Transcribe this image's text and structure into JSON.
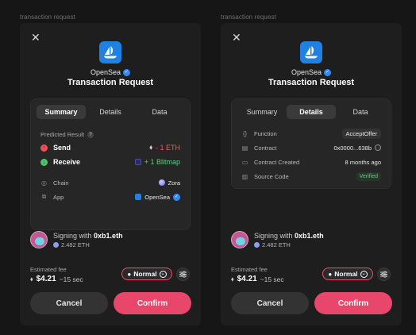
{
  "frame_label": "transaction request",
  "app": {
    "name": "OpenSea",
    "title": "Transaction Request"
  },
  "tabs": [
    "Summary",
    "Details",
    "Data"
  ],
  "summary": {
    "heading": "Predicted Result",
    "send": {
      "label": "Send",
      "value": "- 1 ETH"
    },
    "receive": {
      "label": "Receive",
      "value": "+ 1 Blitmap"
    },
    "chain": {
      "label": "Chain",
      "value": "Zora"
    },
    "app_row": {
      "label": "App",
      "value": "OpenSea"
    }
  },
  "details": {
    "function": {
      "label": "Function",
      "value": "AcceptOffer"
    },
    "contract": {
      "label": "Contract",
      "value": "0x0000...638b"
    },
    "contract_created": {
      "label": "Contract Created",
      "value": "8 months ago"
    },
    "source_code": {
      "label": "Source Code",
      "value": "Verified"
    }
  },
  "signer": {
    "prefix": "Signing with",
    "address": "0xb1.eth",
    "balance": "2.482 ETH"
  },
  "fee": {
    "label": "Estimated fee",
    "usd": "$4.21",
    "eta": "~15 sec",
    "speed": "Normal"
  },
  "buttons": {
    "cancel": "Cancel",
    "confirm": "Confirm"
  },
  "colors": {
    "accent": "#e8466a",
    "brand": "#2081e2",
    "success": "#5fd078",
    "danger": "#ef5a63"
  },
  "active_tabs": {
    "left": "Summary",
    "right": "Details"
  }
}
